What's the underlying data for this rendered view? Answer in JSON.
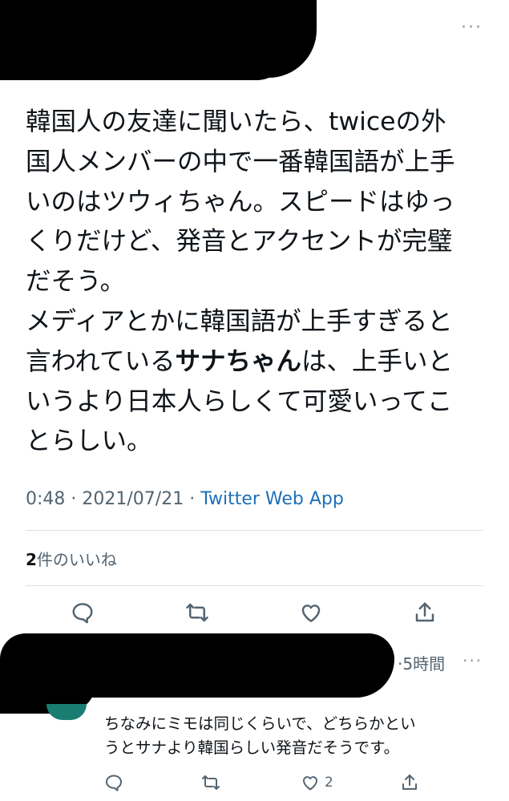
{
  "tweet": {
    "body_lines": [
      "韓国人の友達に聞いたら、twiceの外",
      "国人メンバーの中で一番韓国語が上手",
      "いのはツウィちゃん。スピードはゆっ",
      "くりだけど、発音とアクセントが完璧",
      "だそう。",
      "メディアとかに韓国語が上手すぎると"
    ],
    "line7_pre": "言われている",
    "line7_bold": "サナちゃん",
    "line7_post": "は、上手いと",
    "line8": "いうより日本人らしくて可愛いってこ",
    "line9": "とらしい。",
    "time": "0:48",
    "sep1": " · ",
    "date": "2021/07/21",
    "sep2": " · ",
    "app": "Twitter Web App",
    "likes_count": "2",
    "likes_label": "件のいいね",
    "more": "···"
  },
  "reply": {
    "time_label": "·5時間",
    "more": "···",
    "text": "ちなみにミモは同じくらいで、どちらかとい\nうとサナより韓国らしい発音だそうです。",
    "like_count": "2"
  },
  "icons": [
    "reply-icon",
    "retweet-icon",
    "like-icon",
    "share-icon"
  ]
}
